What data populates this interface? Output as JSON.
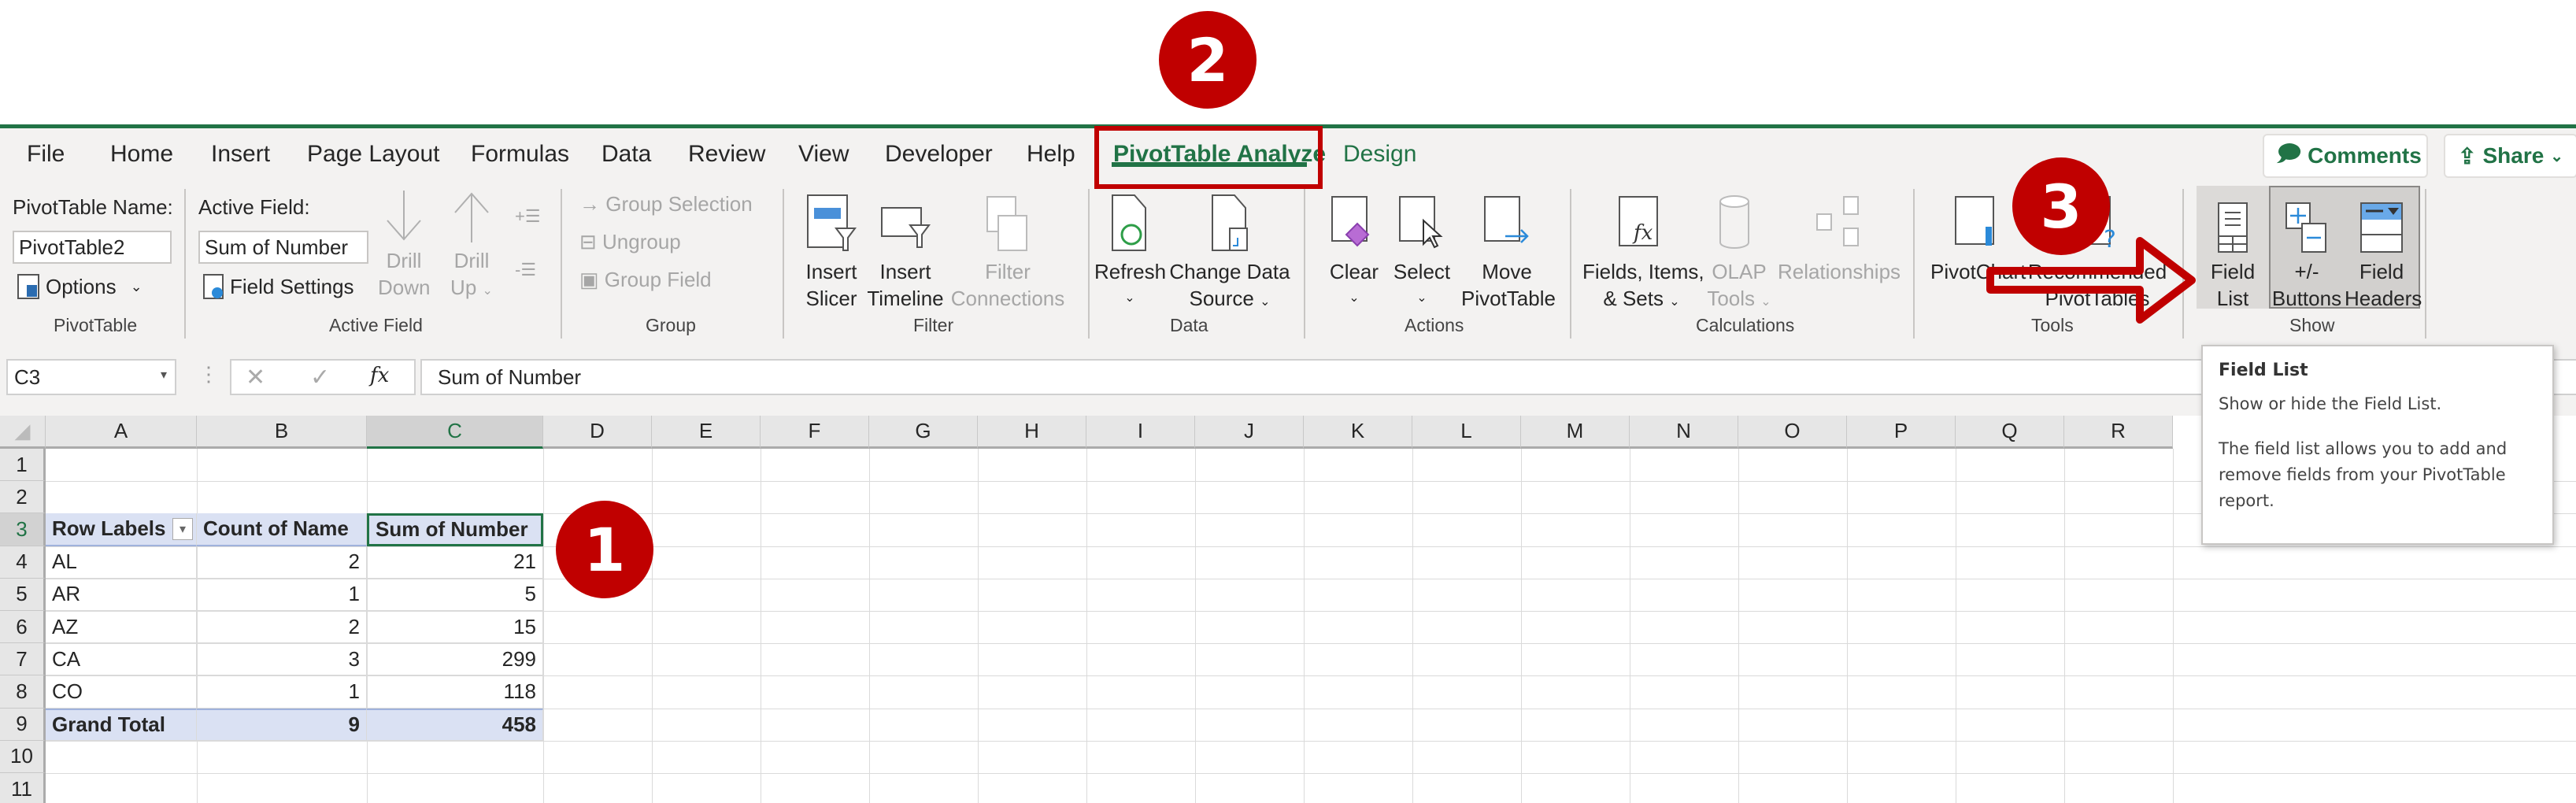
{
  "tabs": {
    "items": [
      {
        "label": "File",
        "state": "normal"
      },
      {
        "label": "Home",
        "state": "normal"
      },
      {
        "label": "Insert",
        "state": "normal"
      },
      {
        "label": "Page Layout",
        "state": "normal"
      },
      {
        "label": "Formulas",
        "state": "normal"
      },
      {
        "label": "Data",
        "state": "normal"
      },
      {
        "label": "Review",
        "state": "normal"
      },
      {
        "label": "View",
        "state": "normal"
      },
      {
        "label": "Developer",
        "state": "normal"
      },
      {
        "label": "Help",
        "state": "normal"
      },
      {
        "label": "PivotTable Analyze",
        "state": "active"
      },
      {
        "label": "Design",
        "state": "contextual"
      }
    ],
    "comments_label": "Comments",
    "share_label": "Share"
  },
  "ribbon": {
    "pivottable": {
      "name_label": "PivotTable Name:",
      "name_value": "PivotTable2",
      "options_label": "Options",
      "group_label": "PivotTable"
    },
    "active_field": {
      "label": "Active Field:",
      "value": "Sum of Number",
      "field_settings_label": "Field Settings",
      "drill_down_line1": "Drill",
      "drill_down_line2": "Down",
      "drill_up_line1": "Drill",
      "drill_up_line2": "Up",
      "group_label": "Active Field"
    },
    "group": {
      "group_selection_label": "Group Selection",
      "ungroup_label": "Ungroup",
      "group_field_label": "Group Field",
      "group_label": "Group"
    },
    "filter": {
      "insert_slicer_line1": "Insert",
      "insert_slicer_line2": "Slicer",
      "insert_timeline_line1": "Insert",
      "insert_timeline_line2": "Timeline",
      "filter_connections_line1": "Filter",
      "filter_connections_line2": "Connections",
      "group_label": "Filter"
    },
    "data": {
      "refresh_label": "Refresh",
      "change_source_line1": "Change Data",
      "change_source_line2": "Source",
      "group_label": "Data"
    },
    "actions": {
      "clear_label": "Clear",
      "select_label": "Select",
      "move_line1": "Move",
      "move_line2": "PivotTable",
      "group_label": "Actions"
    },
    "calculations": {
      "fields_line1": "Fields, Items,",
      "fields_line2": "& Sets",
      "olap_line1": "OLAP",
      "olap_line2": "Tools",
      "relationships_label": "Relationships",
      "group_label": "Calculations"
    },
    "tools": {
      "pivotchart_label": "PivotChart",
      "recommended_line1": "Recommended",
      "recommended_line2": "PivotTables",
      "group_label": "Tools"
    },
    "show": {
      "field_list_line1": "Field",
      "field_list_line2": "List",
      "buttons_line1": "+/-",
      "buttons_line2": "Buttons",
      "headers_line1": "Field",
      "headers_line2": "Headers",
      "group_label": "Show"
    }
  },
  "formula_bar": {
    "name_box": "C3",
    "formula": "Sum of Number"
  },
  "sheet": {
    "columns": [
      "A",
      "B",
      "C",
      "D",
      "E",
      "F",
      "G",
      "H",
      "I",
      "J",
      "K",
      "L",
      "M",
      "N",
      "O",
      "P",
      "Q",
      "R"
    ],
    "rows": [
      "1",
      "2",
      "3",
      "4",
      "5",
      "6",
      "7",
      "8",
      "9",
      "10",
      "11"
    ],
    "selected_cell": "C3",
    "pivot": {
      "headers": [
        "Row Labels",
        "Count of Name",
        "Sum of Number"
      ],
      "rows": [
        {
          "label": "AL",
          "count": "2",
          "sum": "21"
        },
        {
          "label": "AR",
          "count": "1",
          "sum": "5"
        },
        {
          "label": "AZ",
          "count": "2",
          "sum": "15"
        },
        {
          "label": "CA",
          "count": "3",
          "sum": "299"
        },
        {
          "label": "CO",
          "count": "1",
          "sum": "118"
        }
      ],
      "total": {
        "label": "Grand Total",
        "count": "9",
        "sum": "458"
      }
    }
  },
  "tooltip": {
    "title": "Field List",
    "line1": "Show or hide the Field List.",
    "line2": "The field list allows you to add and remove fields from your PivotTable report."
  },
  "annotations": {
    "step1": "1",
    "step2": "2",
    "step3": "3",
    "color": "#c00000"
  }
}
